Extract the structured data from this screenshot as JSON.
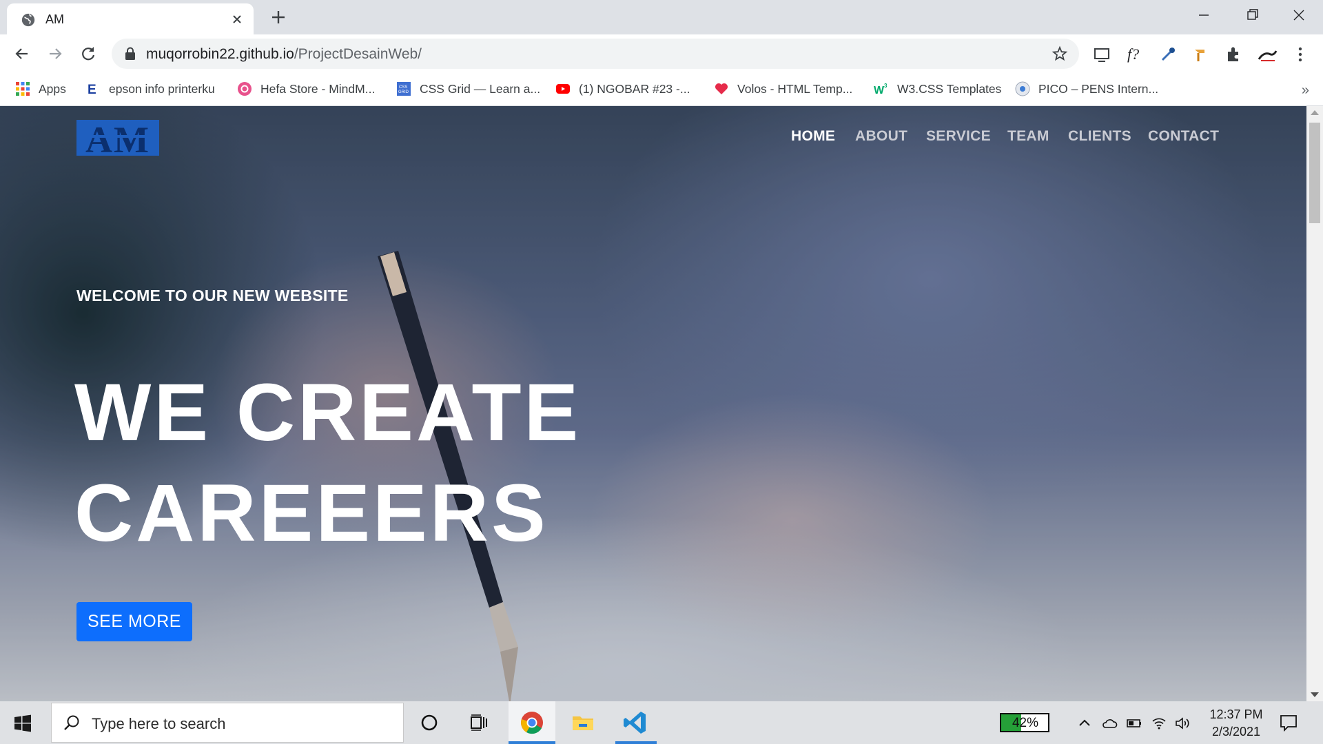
{
  "browser": {
    "tab_title": "AM",
    "url_host": "muqorrobin22.github.io",
    "url_path": "/ProjectDesainWeb/",
    "bookmarks": [
      {
        "label": "Apps",
        "icon": "apps-grid-icon"
      },
      {
        "label": "epson info printerku",
        "icon": "epson-e-icon"
      },
      {
        "label": "Hefa Store - MindM...",
        "icon": "hefa-store-icon"
      },
      {
        "label": "CSS Grid — Learn a...",
        "icon": "css-grid-icon"
      },
      {
        "label": "(1) NGOBAR #23 -...",
        "icon": "youtube-icon"
      },
      {
        "label": "Volos - HTML Temp...",
        "icon": "heart-icon"
      },
      {
        "label": "W3.CSS Templates",
        "icon": "w3-icon"
      },
      {
        "label": "PICO – PENS Intern...",
        "icon": "pico-icon"
      }
    ],
    "bookmarks_more": "»"
  },
  "site": {
    "logo_text": "AM",
    "nav": [
      "HOME",
      "ABOUT",
      "SERVICE",
      "TEAM",
      "CLIENTS",
      "CONTACT"
    ],
    "active_nav": "HOME",
    "welcome": "WELCOME TO OUR NEW WEBSITE",
    "headline_line1": "WE CREATE",
    "headline_line2": "CAREEERS",
    "cta": "SEE MORE",
    "colors": {
      "cta": "#0d6efd",
      "logo_bg": "#1f5fbf",
      "logo_text": "#0b2f6e"
    }
  },
  "taskbar": {
    "search_placeholder": "Type here to search",
    "battery_label": "42%",
    "battery_percent": 42,
    "time": "12:37 PM",
    "date": "2/3/2021"
  }
}
